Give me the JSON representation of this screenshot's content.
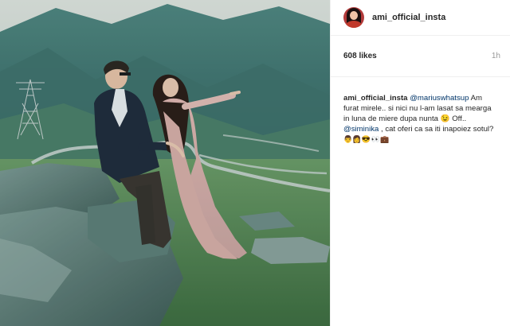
{
  "post": {
    "username": "ami_official_insta",
    "likes": "608 likes",
    "time": "1h",
    "caption": {
      "username": "ami_official_insta",
      "mention1": "@mariuswhatsup",
      "text1": " Am furat mirele.. si nici nu l-am lasat sa mearga in luna de miere dupa nunta 😉 Off..",
      "mention2": "@siminika",
      "text2": " , cat oferi ca sa iti inapoiez sotul?",
      "emojis": "👨‍👩😎👀💼"
    }
  },
  "colors": {
    "mention": "#003569",
    "border": "#efefef",
    "sky": "#cfd7d3",
    "mountain": "#3f7570"
  }
}
